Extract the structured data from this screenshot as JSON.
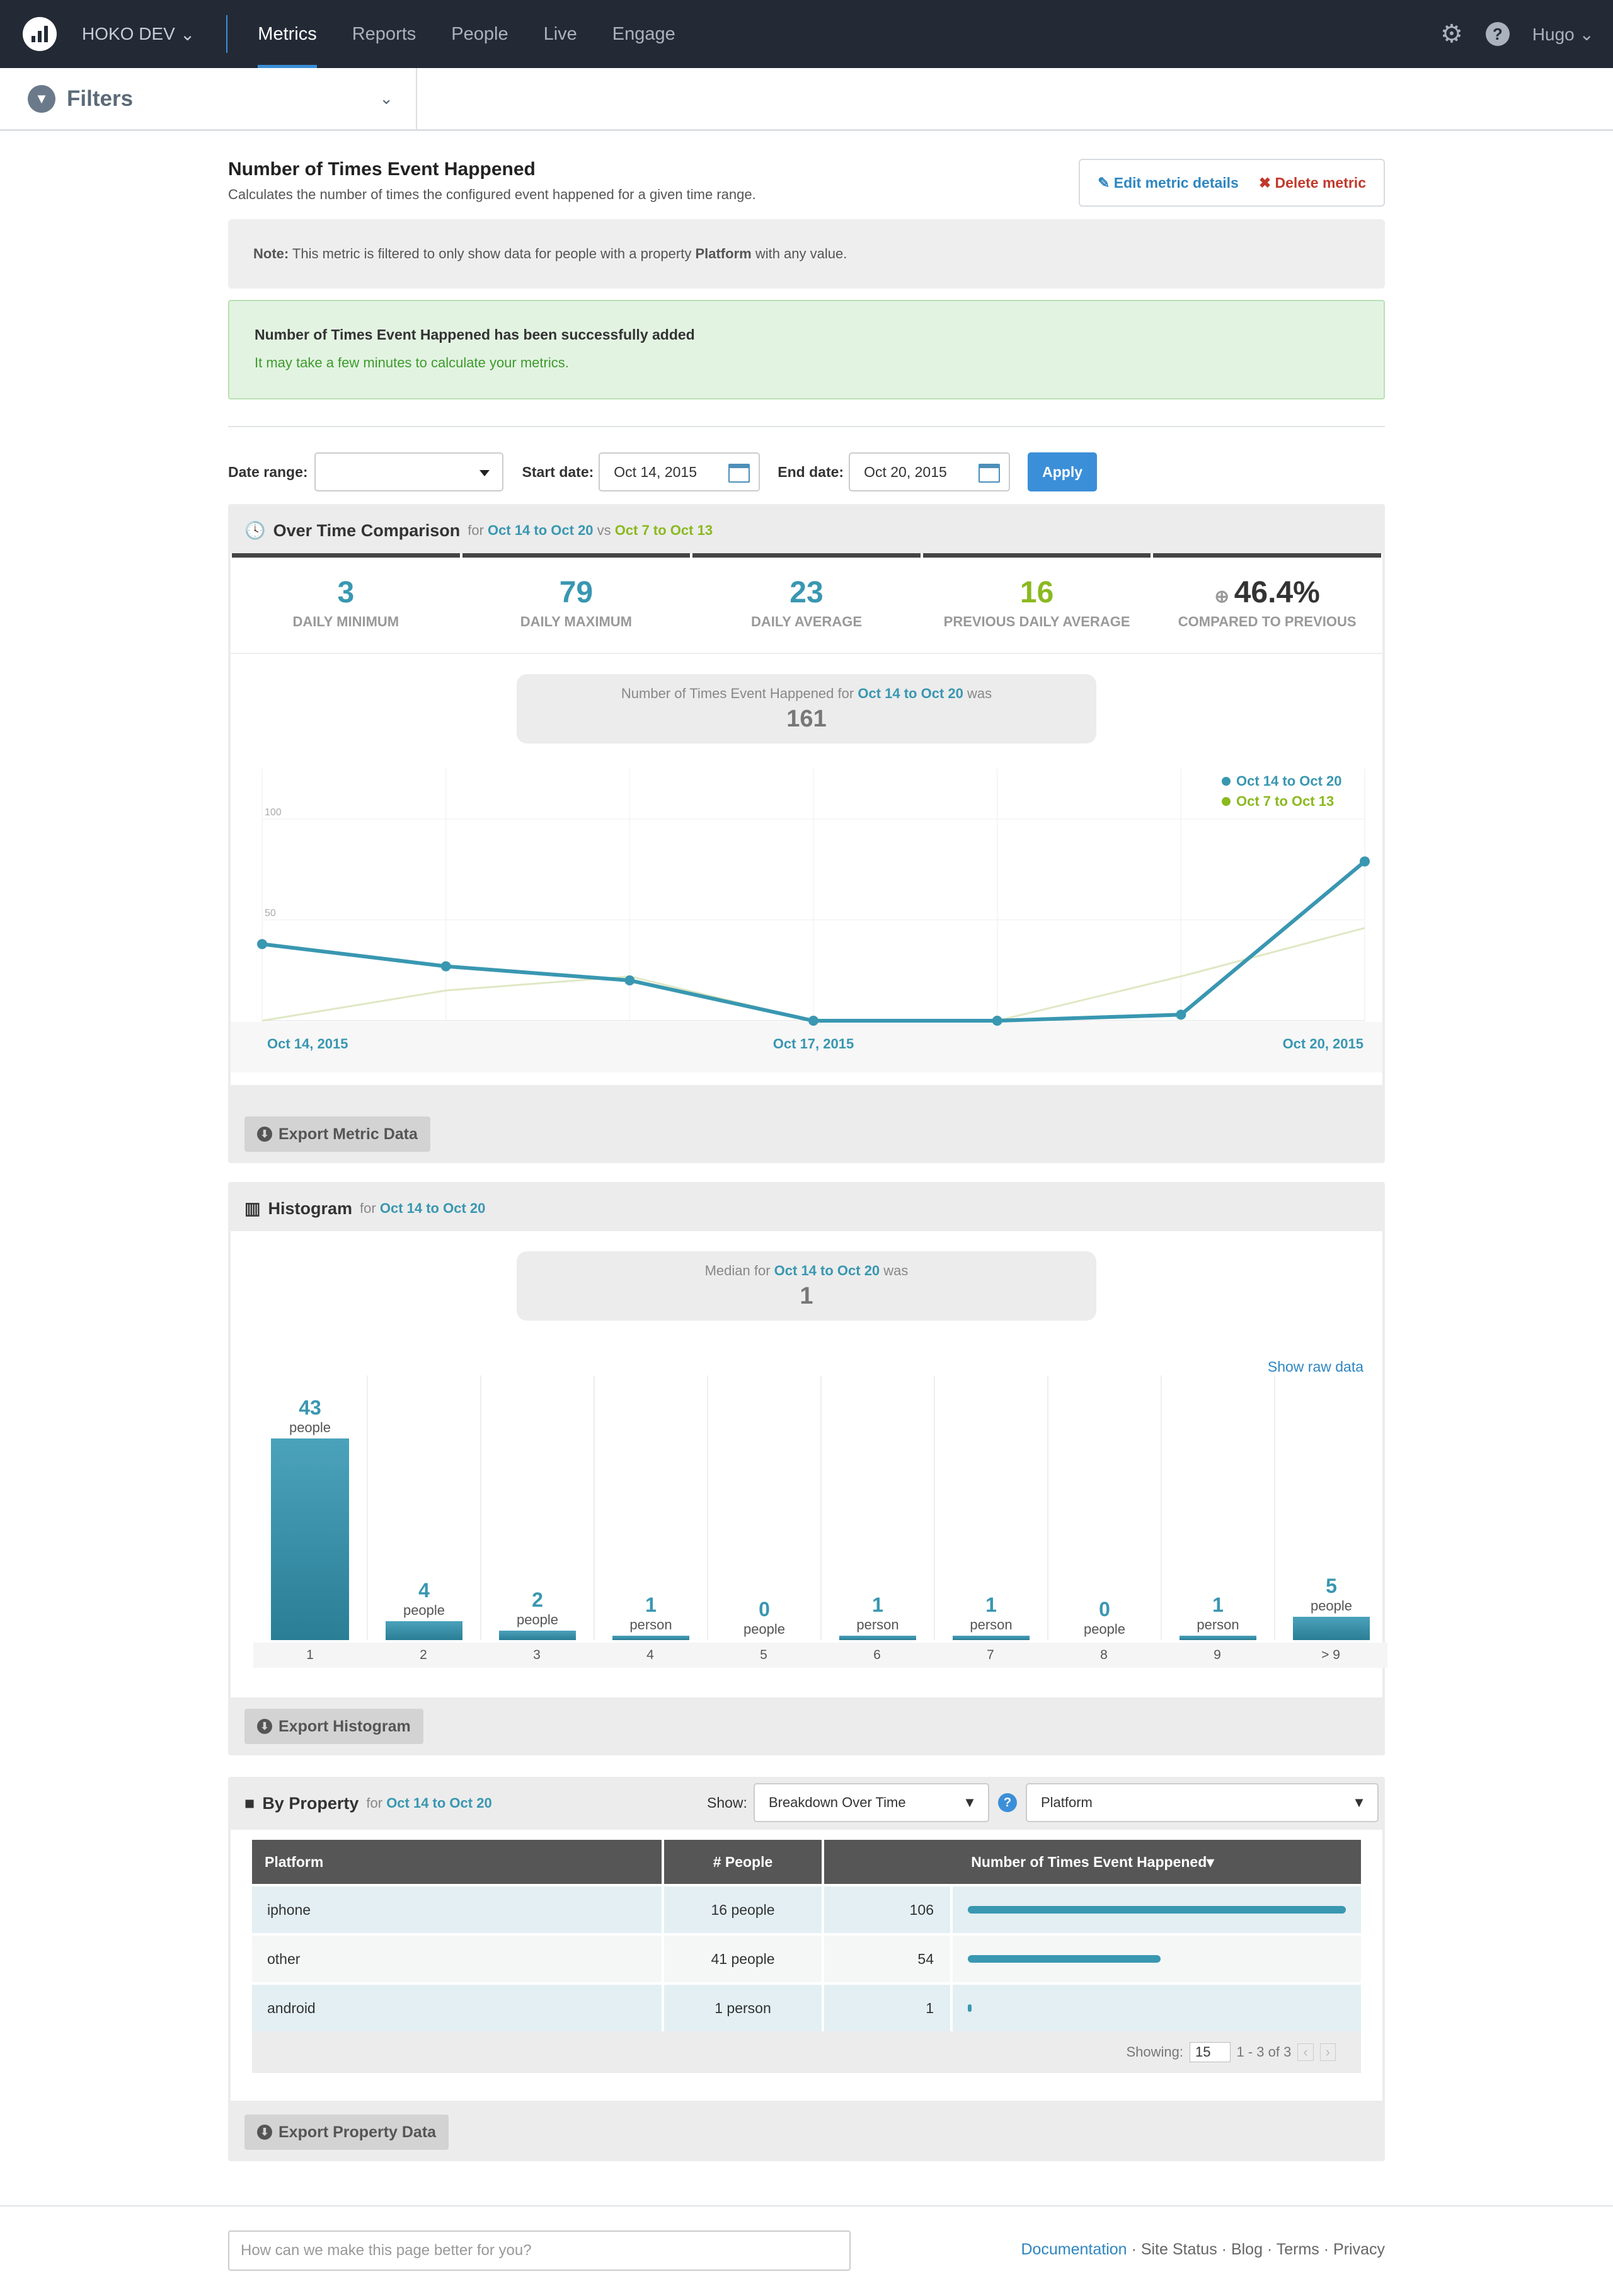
{
  "nav": {
    "project": "HOKO DEV",
    "tabs": [
      "Metrics",
      "Reports",
      "People",
      "Live",
      "Engage"
    ],
    "active_tab": 0,
    "user": "Hugo",
    "settings_icon": "gear-icon",
    "help_icon": "question-icon"
  },
  "filters": {
    "label": "Filters"
  },
  "metric": {
    "title": "Number of Times Event Happened",
    "description": "Calculates the number of times the configured event happened for a given time range.",
    "edit_label": "Edit metric details",
    "delete_label": "Delete metric"
  },
  "note": {
    "prefix": "Note:",
    "text1": " This metric is filtered to only show data for people with a property ",
    "property": "Platform",
    "text2": " with any value."
  },
  "success": {
    "heading": "Number of Times Event Happened has been successfully added",
    "message": "It may take a few minutes to calculate your metrics."
  },
  "date_controls": {
    "range_label": "Date range:",
    "range_value": "",
    "start_label": "Start date:",
    "start_value": "Oct 14, 2015",
    "end_label": "End date:",
    "end_value": "Oct 20, 2015",
    "apply_label": "Apply"
  },
  "over_time": {
    "title": "Over Time Comparison",
    "for": "for",
    "current": "Oct 14 to Oct 20",
    "vs": "vs",
    "previous": "Oct 7 to Oct 13",
    "stats": [
      {
        "value": "3",
        "label": "DAILY MINIMUM",
        "color": "#3997b1"
      },
      {
        "value": "79",
        "label": "DAILY MAXIMUM",
        "color": "#3997b1"
      },
      {
        "value": "23",
        "label": "DAILY AVERAGE",
        "color": "#3997b1"
      },
      {
        "value": "16",
        "label": "PREVIOUS DAILY AVERAGE",
        "color": "#8bb91f"
      },
      {
        "value": "46.4%",
        "label": "COMPARED TO PREVIOUS",
        "color": "#333333"
      }
    ],
    "summary_prefix": "Number of Times Event Happened",
    "summary_for": "for",
    "summary_range": "Oct 14 to Oct 20",
    "summary_was": "was",
    "summary_value": "161",
    "export_label": "Export Metric Data"
  },
  "chart_data": {
    "type": "line",
    "x": [
      "Oct 14, 2015",
      "Oct 15, 2015",
      "Oct 16, 2015",
      "Oct 17, 2015",
      "Oct 18, 2015",
      "Oct 19, 2015",
      "Oct 20, 2015"
    ],
    "x_tick_labels": [
      "Oct 14, 2015",
      "Oct 17, 2015",
      "Oct 20, 2015"
    ],
    "y_ticks": [
      "50",
      "100"
    ],
    "ylim": [
      0,
      125
    ],
    "grid": true,
    "legend": "top-right",
    "series": [
      {
        "name": "Oct 14 to Oct 20",
        "color": "#3997b1",
        "values": [
          38,
          27,
          20,
          0,
          0,
          3,
          79
        ]
      },
      {
        "name": "Oct 7 to Oct 13",
        "color": "#8bb91f",
        "values": [
          0,
          15,
          22,
          0,
          0,
          22,
          46
        ]
      }
    ]
  },
  "histogram": {
    "title": "Histogram",
    "for": "for",
    "range": "Oct 14 to Oct 20",
    "median_prefix": "Median for",
    "median_range": "Oct 14 to Oct 20",
    "median_was": "was",
    "median_value": "1",
    "show_raw": "Show raw data",
    "export_label": "Export Histogram",
    "bins": [
      {
        "label": "1",
        "count": "43",
        "unit": "people"
      },
      {
        "label": "2",
        "count": "4",
        "unit": "people"
      },
      {
        "label": "3",
        "count": "2",
        "unit": "people"
      },
      {
        "label": "4",
        "count": "1",
        "unit": "person"
      },
      {
        "label": "5",
        "count": "0",
        "unit": "people"
      },
      {
        "label": "6",
        "count": "1",
        "unit": "person"
      },
      {
        "label": "7",
        "count": "1",
        "unit": "person"
      },
      {
        "label": "8",
        "count": "0",
        "unit": "people"
      },
      {
        "label": "9",
        "count": "1",
        "unit": "person"
      },
      {
        "label": "> 9",
        "count": "5",
        "unit": "people"
      }
    ]
  },
  "by_property": {
    "title": "By Property",
    "for": "for",
    "range": "Oct 14 to Oct 20",
    "show_label": "Show:",
    "show_value": "Breakdown Over Time",
    "property_value": "Platform",
    "columns": [
      "Platform",
      "# People",
      "Number of Times Event Happened"
    ],
    "rows": [
      {
        "platform": "iphone",
        "people": "16 people",
        "count": "106",
        "fraction": 1.0
      },
      {
        "platform": "other",
        "people": "41 people",
        "count": "54",
        "fraction": 0.51
      },
      {
        "platform": "android",
        "people": "1 person",
        "count": "1",
        "fraction": 0.01
      }
    ],
    "showing_label": "Showing:",
    "page_size": "15",
    "range_text": "1 - 3 of 3",
    "export_label": "Export Property Data"
  },
  "footer": {
    "feedback_placeholder": "How can we make this page better for you?",
    "links": [
      "Documentation",
      "Site Status",
      "Blog",
      "Terms",
      "Privacy"
    ]
  }
}
